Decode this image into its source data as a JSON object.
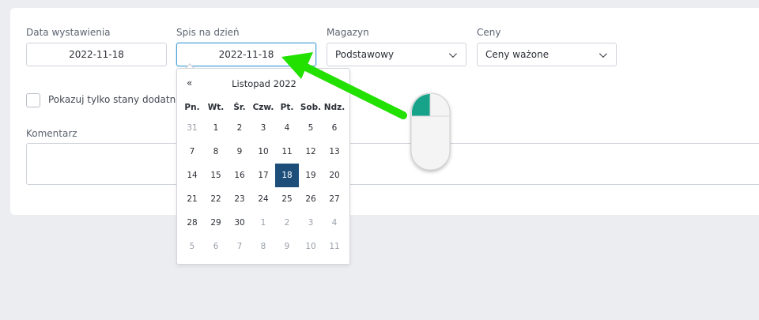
{
  "form": {
    "issue_date": {
      "label": "Data wystawienia",
      "value": "2022-11-18"
    },
    "inventory_date": {
      "label": "Spis na dzień",
      "value": "2022-11-18"
    },
    "warehouse": {
      "label": "Magazyn",
      "value": "Podstawowy"
    },
    "prices": {
      "label": "Ceny",
      "value": "Ceny ważone"
    },
    "positive_only": {
      "label": "Pokazuj tylko stany dodatnie",
      "checked": false
    },
    "comment": {
      "label": "Komentarz",
      "value": ""
    }
  },
  "datepicker": {
    "prev": "«",
    "title": "Listopad 2022",
    "weekdays": [
      "Pn.",
      "Wt.",
      "Śr.",
      "Czw.",
      "Pt.",
      "Sob.",
      "Ndz."
    ],
    "weeks": [
      [
        "31",
        "1",
        "2",
        "3",
        "4",
        "5",
        "6"
      ],
      [
        "7",
        "8",
        "9",
        "10",
        "11",
        "12",
        "13"
      ],
      [
        "14",
        "15",
        "16",
        "17",
        "18",
        "19",
        "20"
      ],
      [
        "21",
        "22",
        "23",
        "24",
        "25",
        "26",
        "27"
      ],
      [
        "28",
        "29",
        "30",
        "1",
        "2",
        "3",
        "4"
      ],
      [
        "5",
        "6",
        "7",
        "8",
        "9",
        "10",
        "11"
      ]
    ],
    "muted": [
      [
        0,
        0
      ],
      [
        4,
        3
      ],
      [
        4,
        4
      ],
      [
        4,
        5
      ],
      [
        4,
        6
      ],
      [
        5,
        0
      ],
      [
        5,
        1
      ],
      [
        5,
        2
      ],
      [
        5,
        3
      ],
      [
        5,
        4
      ],
      [
        5,
        5
      ],
      [
        5,
        6
      ]
    ],
    "selected": [
      2,
      4
    ]
  },
  "colors": {
    "selected_day": "#1d4e7a",
    "arrow": "#22e000",
    "mouse_button": "#17a38a",
    "focus_border": "#4fa3d9"
  },
  "icons": {
    "select_caret": "chevron-down-icon",
    "annotation_arrow": "green-arrow-icon",
    "mouse": "mouse-icon"
  }
}
